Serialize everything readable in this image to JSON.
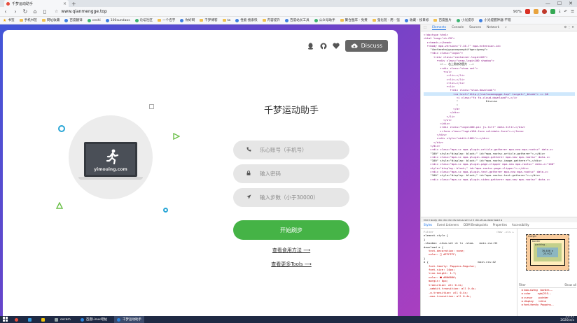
{
  "browser": {
    "tab_title": "千梦运动助手",
    "new_tab_label": "+",
    "window_controls": [
      "—",
      "☐",
      "✕"
    ],
    "url": "www.qianmengge.top",
    "zoom": "90%",
    "bookmarks": [
      "书签",
      "手机书签",
      "网址收藏",
      "百度翻译",
      "ceshi",
      "100sundaos",
      "论坛社区",
      "一个名字",
      "你好啊",
      "千梦博客",
      "ta",
      "性能·搜索快",
      "内容提升",
      "百度站长工具",
      "公众号助手",
      "聚合图床 - 免费",
      "强化链 - 用 - 强",
      "收藏 - 按目标",
      "百度图片",
      "小光提示",
      "小光提醒神器-不错"
    ]
  },
  "page": {
    "discuss_label": "Discuss",
    "app_title": "千梦运动助手",
    "account_placeholder": "乐心账号（手机号）",
    "password_placeholder": "输入密码",
    "steps_placeholder": "输入步数（小于30000）",
    "start_label": "开始刷步",
    "link_tutorial": "查看食用方法 ⟶",
    "link_more_tools": "查看更多Tools ⟶",
    "illustration_domain": "yimouing.com",
    "accent_color": "#45b346"
  },
  "devtools": {
    "tabs": [
      "Elements",
      "Console",
      "Sources",
      "Network",
      "»"
    ],
    "tree": [
      "<!doctype html>",
      "<html lang=\"zh-CN\">",
      "  ▸<head>…</head>",
      "  ▾<body mpa-version=\"7.16.7\" mpa-extension-id=",
      "    \"ibefaeehajgcpooopoegkifhgecigeeg\">",
      "    ▾<div class=\"login\">",
      "      ▾<div class=\"container-login100\">",
      "        ▾<div class=\"wrap-login100 shadow\">",
      "          <!-- 右上角修改图片 -->",
      "          ▾<div class=\"shua-set\">",
      "            ▾<ul>",
      "              ▸<li>…</li>",
      "              ▸<li>…</li>",
      "              ▸<li>…</li>",
      "              ▾<li>",
      "                ▾<div class=\"shua-download\">",
      "                  ▾<a href=\"http://rwilocmenggge.top\" target=\"_blank\"> == $0",
      "                    <i class=\"fa fa-cloud-download\">…</i>",
      "                    \"                 Discuss",
      "                    \"",
      "                  </a>",
      "                </div>",
      "              </li>",
      "            </ul>",
      "          </div>",
      "          ▸<div class=\"login100-pic js-tilt\" data-tilt>…</div>",
      "          ▸<form class=\"login100-form validate-form\">…</form>",
      "        </div>",
      "        ▸<div style=\"width:100%\">…</div>",
      "      </div>",
      "    </div>",
      "    ▸<div class=\"mpa-sc mpa-plugin-article-gatherer mpa-new mpa-rootsc\" data-z=",
      "    \"100\" style=\"display: block;\" id=\"mpa-rootsc-article-gatherer\">…</div>",
      "    ▸<div class=\"mpa-sc mpa-plugin-image-gatherer mpa-new mpa-rootsc\" data-z=",
      "    \"100\" style=\"display: block;\" id=\"mpa-rootsc-image-gatherer\">…</div>",
      "    ▸<div class=\"mpa-sc mpa-plugin-page-clipper mpa-new mpa-rootsc\" data-z=\"100\"",
      "    style=\"display: block;\" id=\"mpa-rootsc-page-clipper\">…</div>",
      "    ▸<div class=\"mpa-sc mpa-plugin-text-gatherer mpa-new mpa-rootsc\" data-z=",
      "    \"100\" style=\"display: block;\" id=\"mpa-rootsc-text-gatherer\">…</div>",
      "    ▸<div class=\"mpa-sc mpa-plugin-video-gatherer mpa-new mpa-rootsc\" data-z="
    ],
    "breadcrumbs": "html  body  div  div  div  div.shua-set  ul  li  div.shua-download  a",
    "subtabs": [
      "Styles",
      "Event Listeners",
      "DOM Breakpoints",
      "Properties",
      "Accessibility"
    ],
    "styles_filter": "Filter",
    "styles_hov": ":hov  .cls  +",
    "styles": [
      "element.style {",
      "}",
      ".shuabox .shua-set ul li .shua-   main.css:32",
      "download a {",
      "   text-decoration: none;",
      "   color: □ #FFFFFF;",
      "}",
      "a {                              main.css:42",
      "   font-family: Poppins-Regular;",
      "   font-size: 14px;",
      "   line-height: 1.7;",
      "   color: ■ #666666;",
      "   margin: 0px;",
      "   transition: all 0.4s;",
      "   -webkit-transition: all 0.4s;",
      "   -o-transition: all 0.4s;",
      "   -moz-transition: all 0.4s;"
    ],
    "box_margin": "margin",
    "box_border": "border",
    "box_padding": "padding -",
    "box_content": "76.406 × 23.922",
    "computed_filter": "Filter",
    "computed_show_all": "Show all",
    "computed_props": [
      "▸ box-sizing   border-…",
      "▸ color        rgb(255…",
      "▸ cursor       pointer",
      "▸ display      inline",
      "▸ font-family  Poppins…"
    ]
  },
  "taskbar": {
    "items": [
      "oxcam",
      "百度Linux吧帖",
      "千梦运动助手"
    ],
    "time": "15:31",
    "date": "2020/x/x"
  }
}
